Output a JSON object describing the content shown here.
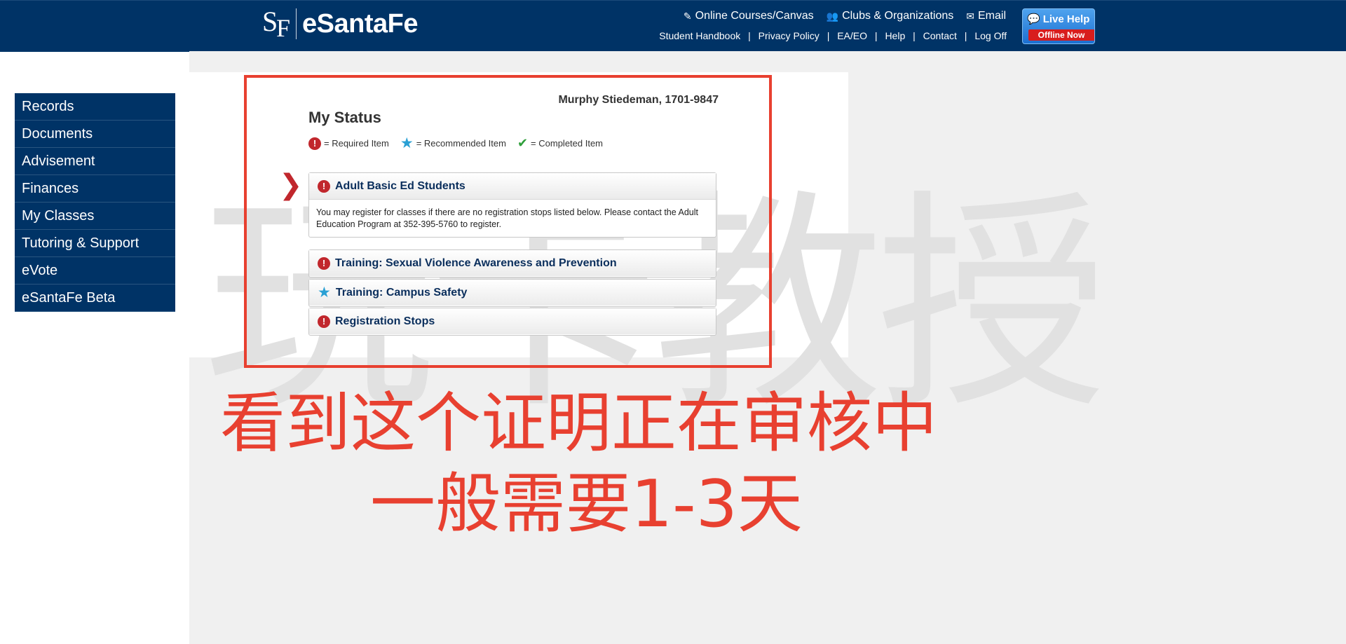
{
  "header": {
    "logo_mark_s": "S",
    "logo_mark_f": "F",
    "logo_text": "eSantaFe",
    "top_links": [
      {
        "icon": "pencil-icon",
        "label": "Online Courses/Canvas"
      },
      {
        "icon": "users-icon",
        "label": "Clubs & Organizations"
      },
      {
        "icon": "envelope-icon",
        "label": "Email"
      }
    ],
    "sub_links": [
      "Student Handbook",
      "Privacy Policy",
      "EA/EO",
      "Help",
      "Contact",
      "Log Off"
    ],
    "sub_link_separator": "|",
    "live_help": {
      "title": "Live Help",
      "status": "Offline Now"
    }
  },
  "sidebar": {
    "items": [
      {
        "label": "Records"
      },
      {
        "label": "Documents"
      },
      {
        "label": "Advisement"
      },
      {
        "label": "Finances"
      },
      {
        "label": "My Classes"
      },
      {
        "label": "Tutoring & Support"
      },
      {
        "label": "eVote"
      },
      {
        "label": "eSantaFe Beta"
      }
    ]
  },
  "status": {
    "student": "Murphy Stiedeman, 1701-9847",
    "title": "My Status",
    "legend": {
      "required": "= Required Item",
      "recommended": "= Recommended Item",
      "completed": "= Completed Item"
    },
    "panels": [
      {
        "icon": "required-icon",
        "title": "Adult Basic Ed Students",
        "body": "You may register for classes if there are no registration stops listed below. Please contact the Adult Education Program at 352-395-5760 to register."
      },
      {
        "icon": "required-icon",
        "title": "Training: Sexual Violence Awareness and Prevention"
      },
      {
        "icon": "star-icon",
        "title": "Training: Campus Safety"
      },
      {
        "icon": "required-icon",
        "title": "Registration Stops"
      }
    ]
  },
  "watermark": "玩卡教授",
  "annotation": {
    "line1": "看到这个证明正在审核中",
    "line2": "一般需要1-3天"
  },
  "colors": {
    "header_bg": "#003366",
    "sidebar_bg": "#003366",
    "required": "#c1272d",
    "recommended": "#2aa0d4",
    "completed": "#2e9e3a",
    "annotation": "#e84030",
    "content_bg": "#f0f0f0"
  }
}
